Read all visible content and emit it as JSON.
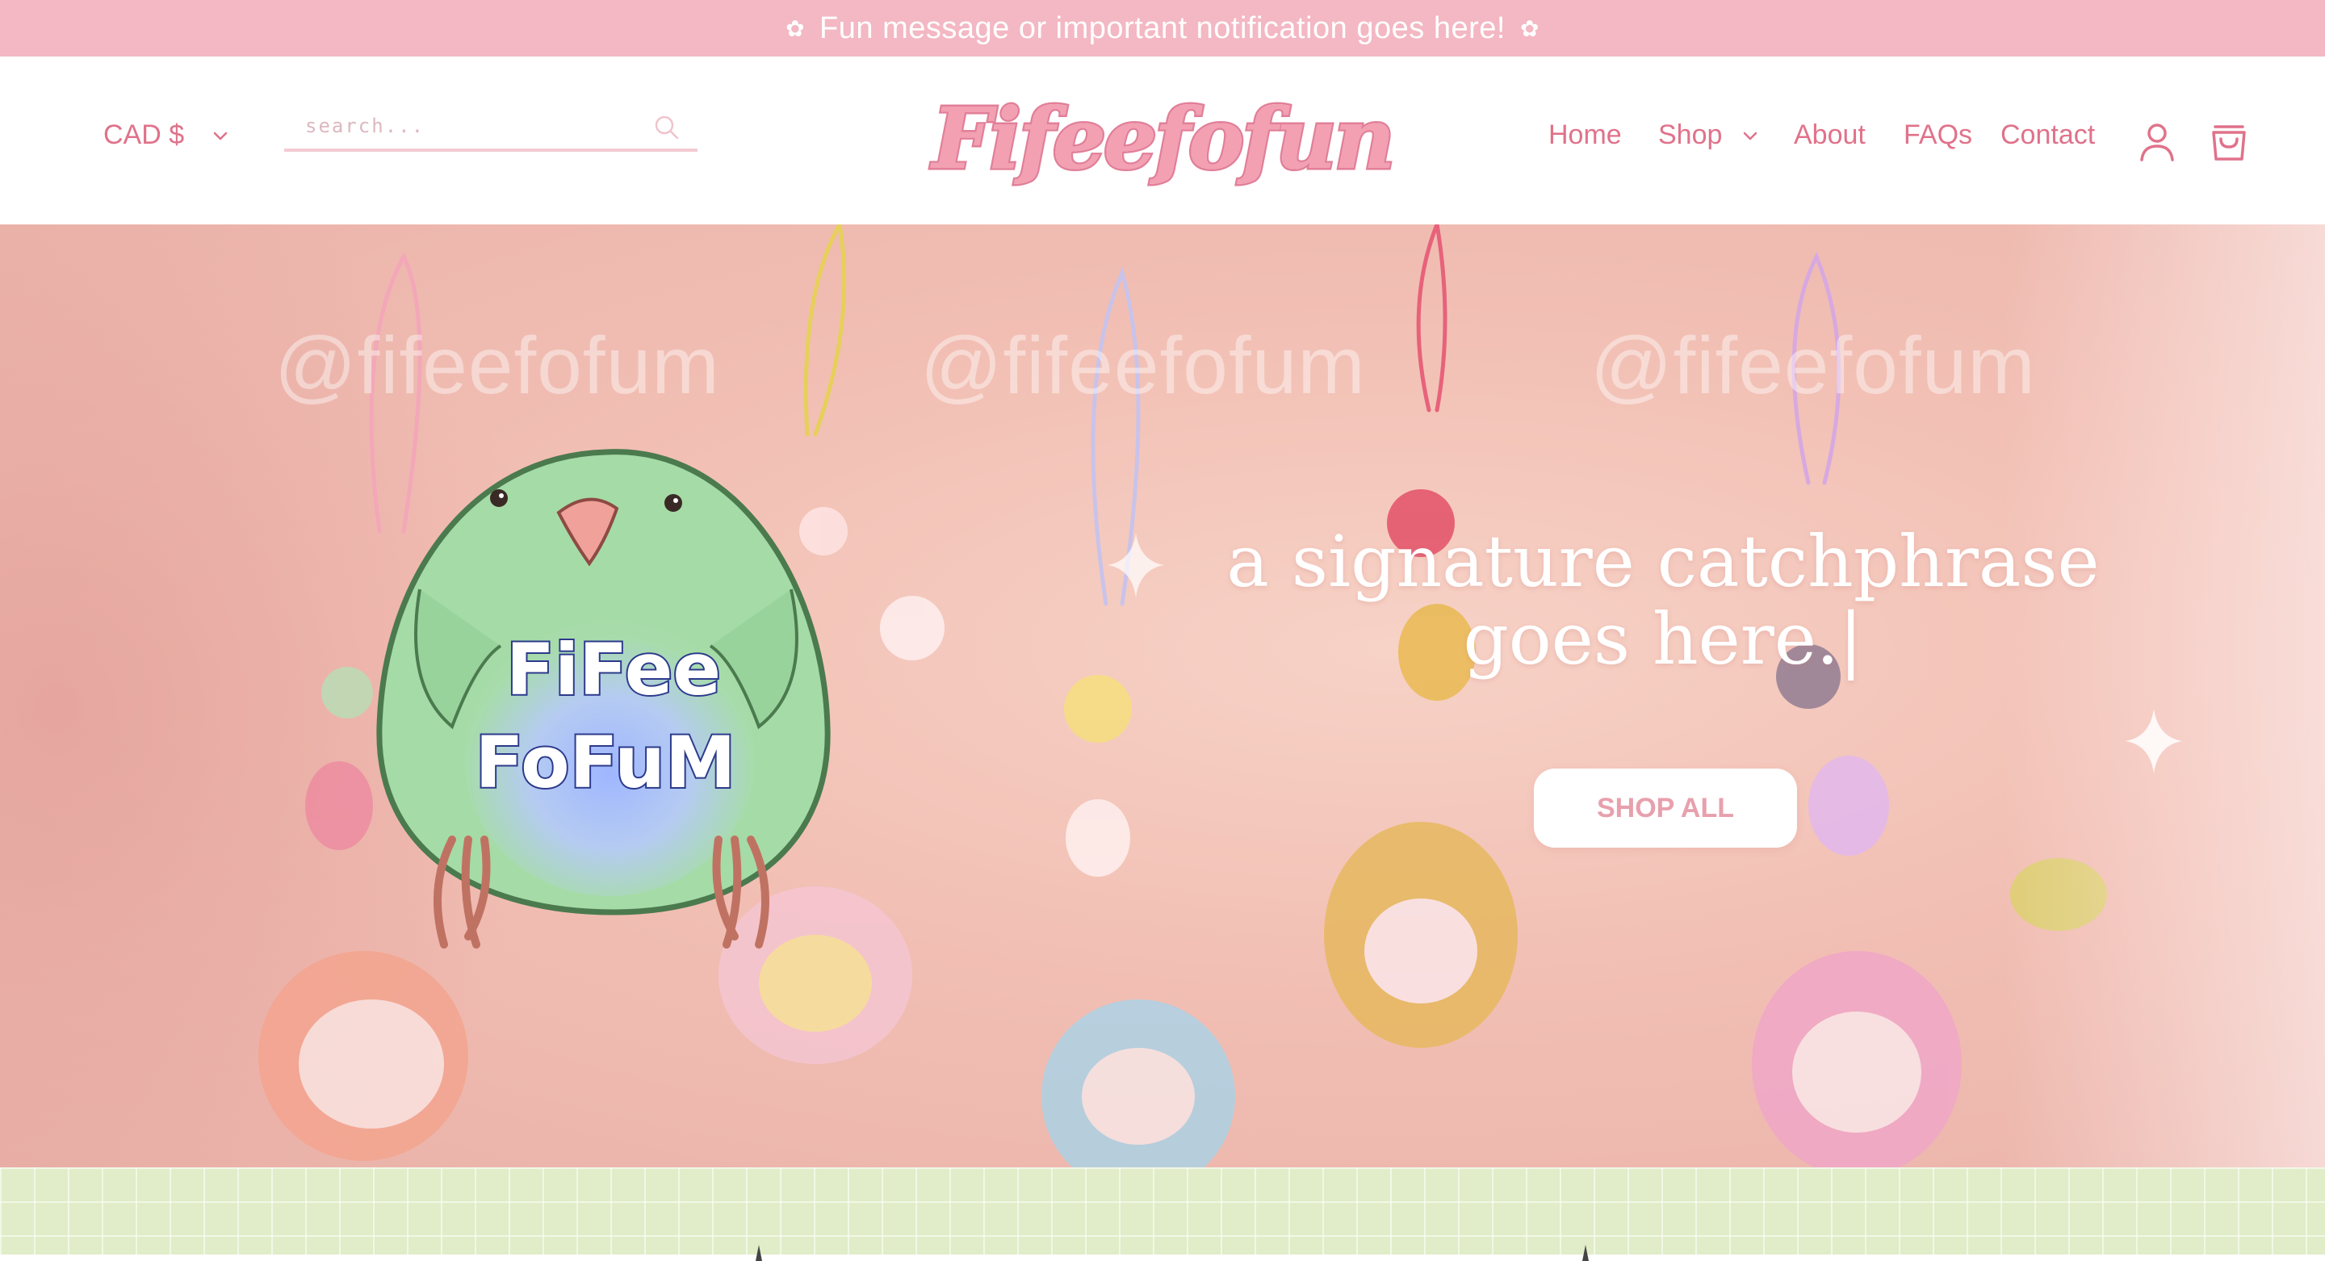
{
  "announcement": {
    "text": "Fun message or important notification goes here!",
    "flower": "✿"
  },
  "header": {
    "currency": "CAD $",
    "search": {
      "placeholder": "search..."
    },
    "logo_text": "Fifeefofun",
    "nav": [
      {
        "label": "Home"
      },
      {
        "label": "Shop"
      },
      {
        "label": "About"
      },
      {
        "label": "FAQs"
      },
      {
        "label": "Contact"
      }
    ],
    "icons": [
      "chevron-down-icon",
      "search-icon",
      "account-icon",
      "cart-icon"
    ]
  },
  "hero": {
    "watermarks": [
      "@fifeefofum",
      "@fifeefofum",
      "@fifeefofum"
    ],
    "mascot_text_line1": "FiFee",
    "mascot_text_line2": "FoFuM",
    "catchphrase": "a signature catchphrase goes here.|",
    "cta_label": "SHOP ALL"
  },
  "colors": {
    "announcement_bg": "#f3b8c3",
    "brand_pink": "#e0728a",
    "hero_bg": "#f2bfb4",
    "grid_strip_bg": "#e0edc8"
  }
}
